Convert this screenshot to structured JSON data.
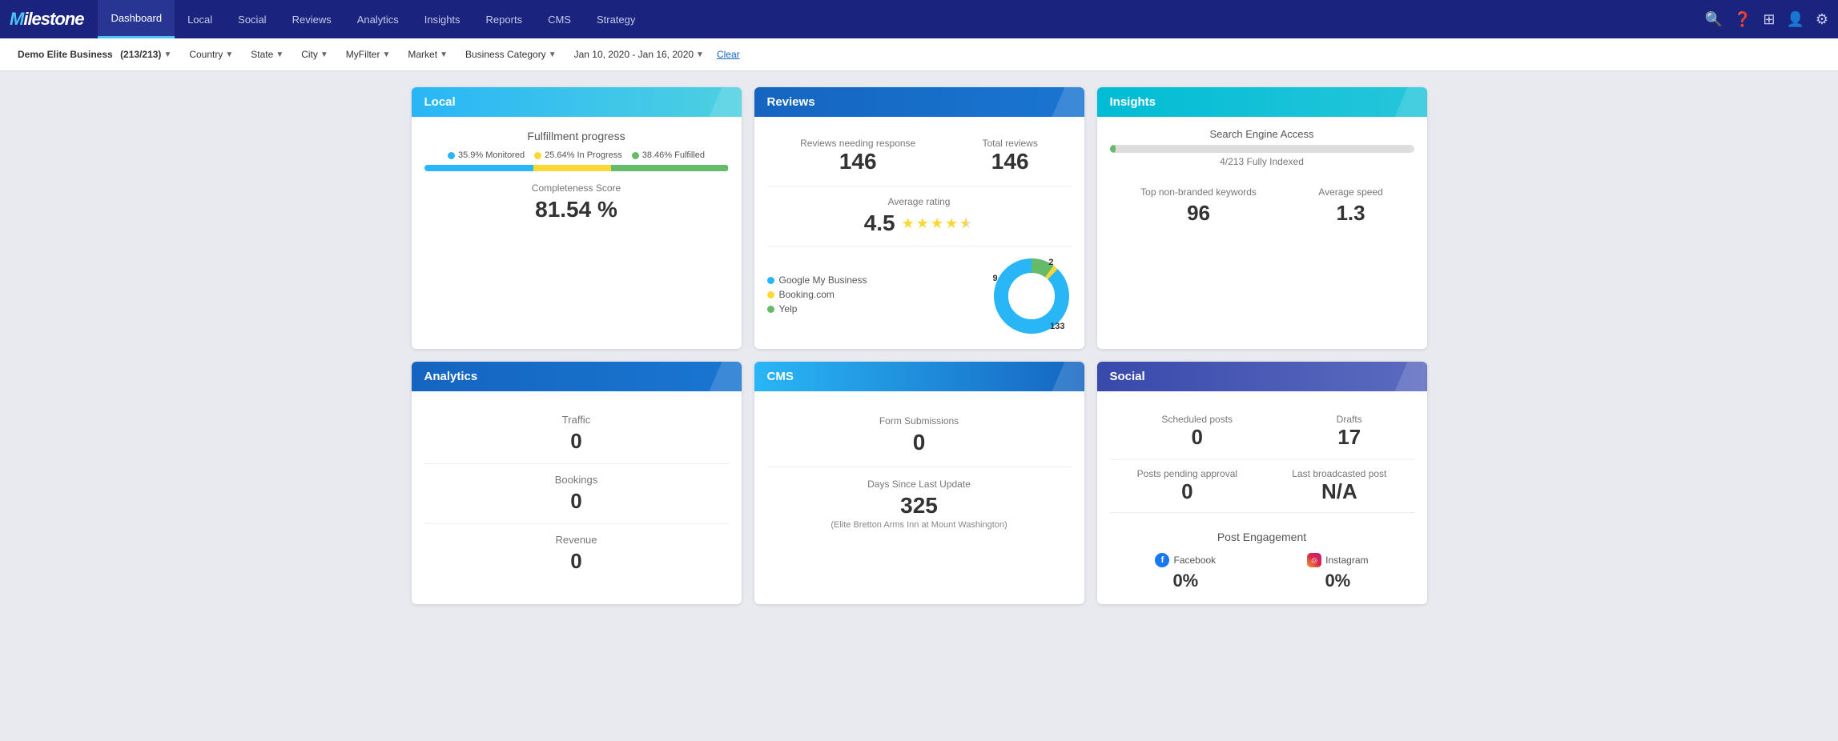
{
  "nav": {
    "logo": "Milestone",
    "items": [
      {
        "label": "Dashboard",
        "active": true
      },
      {
        "label": "Local",
        "active": false
      },
      {
        "label": "Social",
        "active": false
      },
      {
        "label": "Reviews",
        "active": false
      },
      {
        "label": "Analytics",
        "active": false
      },
      {
        "label": "Insights",
        "active": false
      },
      {
        "label": "Reports",
        "active": false
      },
      {
        "label": "CMS",
        "active": false
      },
      {
        "label": "Strategy",
        "active": false
      }
    ]
  },
  "filters": {
    "business": "Demo Elite Business",
    "business_count": "(213/213)",
    "country": "Country",
    "state": "State",
    "city": "City",
    "myfilter": "MyFilter",
    "market": "Market",
    "business_category": "Business Category",
    "date_range": "Jan 10, 2020 - Jan 16, 2020",
    "clear": "Clear"
  },
  "local": {
    "header": "Local",
    "fulfillment_title": "Fulfillment progress",
    "legend": [
      {
        "label": "35.9% Monitored",
        "color": "#29b6f6"
      },
      {
        "label": "25.64% In Progress",
        "color": "#fdd835"
      },
      {
        "label": "38.46% Fulfilled",
        "color": "#66bb6a"
      }
    ],
    "bar_monitored": 35.9,
    "bar_inprogress": 25.64,
    "bar_fulfilled": 38.46,
    "completeness_label": "Completeness Score",
    "completeness_value": "81.54 %"
  },
  "analytics": {
    "header": "Analytics",
    "metrics": [
      {
        "label": "Traffic",
        "value": "0"
      },
      {
        "label": "Bookings",
        "value": "0"
      },
      {
        "label": "Revenue",
        "value": "0"
      }
    ]
  },
  "reviews": {
    "header": "Reviews",
    "needing_response_label": "Reviews needing response",
    "needing_response_value": "146",
    "total_reviews_label": "Total reviews",
    "total_reviews_value": "146",
    "avg_rating_label": "Average rating",
    "avg_rating_value": "4.5",
    "legend": [
      {
        "label": "Google My Business",
        "color": "#29b6f6"
      },
      {
        "label": "Booking.com",
        "color": "#fdd835"
      },
      {
        "label": "Yelp",
        "color": "#66bb6a"
      }
    ],
    "donut": [
      {
        "label": "Google My Business",
        "value": 133,
        "color": "#29b6f6"
      },
      {
        "label": "Booking.com",
        "value": 2,
        "color": "#fdd835"
      },
      {
        "label": "Yelp",
        "value": 9,
        "color": "#66bb6a"
      }
    ],
    "donut_labels": {
      "top": "2",
      "left": "9",
      "bottom": "133"
    }
  },
  "cms": {
    "header": "CMS",
    "form_submissions_label": "Form Submissions",
    "form_submissions_value": "0",
    "days_since_label": "Days Since Last Update",
    "days_since_value": "325",
    "days_since_sub": "(Elite Bretton Arms Inn at Mount Washington)"
  },
  "insights": {
    "header": "Insights",
    "search_engine_title": "Search Engine Access",
    "bar_fill_percent": 2,
    "bar_label": "4/213 Fully Indexed",
    "top_nonbranded_label": "Top non-branded keywords",
    "top_nonbranded_value": "96",
    "avg_speed_label": "Average speed",
    "avg_speed_value": "1.3"
  },
  "social": {
    "header": "Social",
    "scheduled_posts_label": "Scheduled posts",
    "scheduled_posts_value": "0",
    "drafts_label": "Drafts",
    "drafts_value": "17",
    "pending_approval_label": "Posts pending approval",
    "pending_approval_value": "0",
    "last_broadcast_label": "Last broadcasted post",
    "last_broadcast_value": "N/A",
    "post_engagement_title": "Post Engagement",
    "facebook_label": "Facebook",
    "facebook_value": "0%",
    "instagram_label": "Instagram",
    "instagram_value": "0%"
  }
}
